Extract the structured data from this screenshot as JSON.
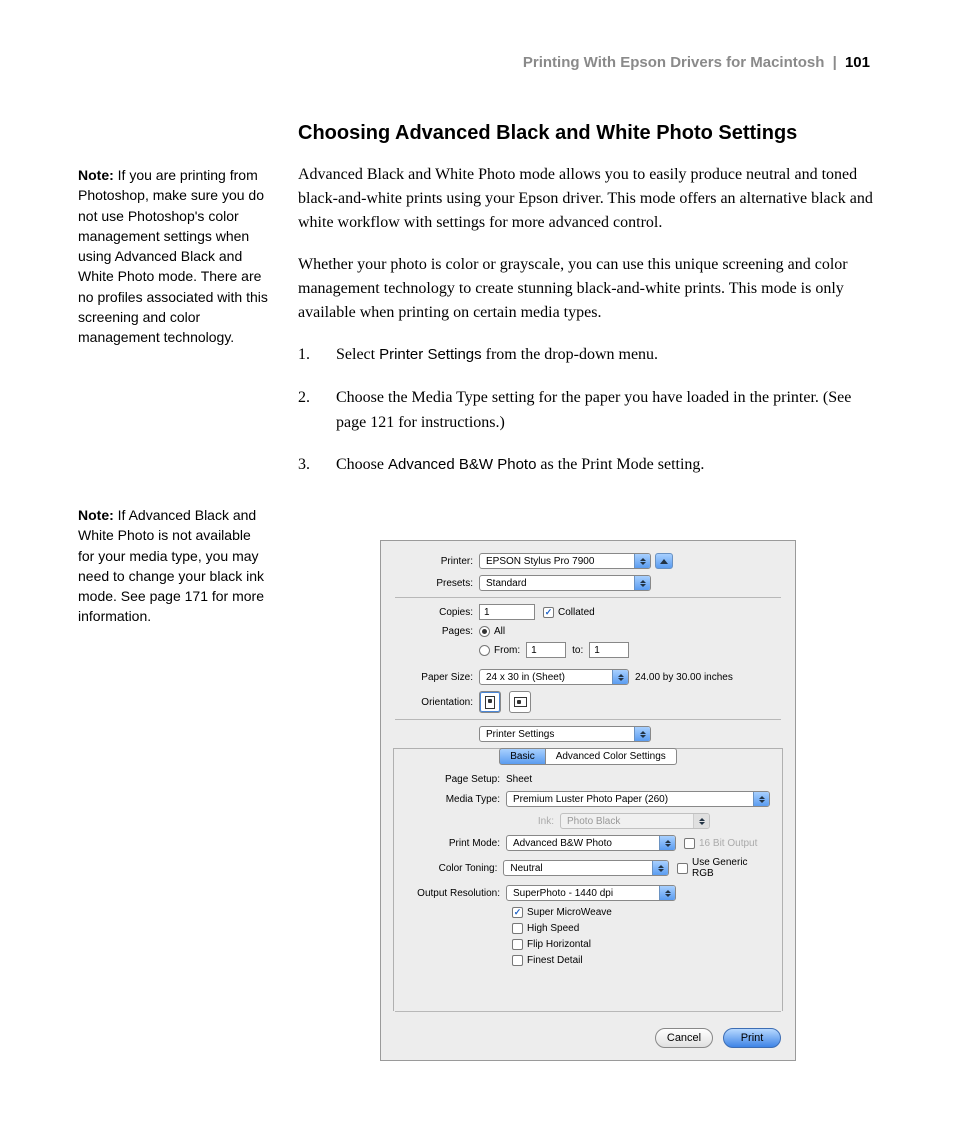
{
  "header": {
    "title": "Printing With Epson Drivers for Macintosh",
    "page": "101"
  },
  "section_title": "Choosing Advanced Black and White Photo Settings",
  "para1": "Advanced Black and White Photo mode allows you to easily produce neutral and toned black-and-white prints using your Epson driver. This mode offers an alternative black and white workflow with settings for more advanced control.",
  "para2": "Whether your photo is color or grayscale, you can use this unique screening and color management technology to create stunning black-and-white prints. This mode is only available when printing on certain media types.",
  "steps": {
    "s1_a": "Select ",
    "s1_b": "Printer Settings",
    "s1_c": " from the drop-down menu.",
    "s2": "Choose the Media Type setting for the paper you have loaded in the printer. (See page 121 for instructions.)",
    "s3_a": "Choose ",
    "s3_b": "Advanced B&W Photo",
    "s3_c": " as the Print Mode setting."
  },
  "notes": {
    "n1_label": "Note:",
    "n1": " If you are printing from Photoshop, make sure you do not use Photoshop's color management settings when using Advanced Black and White Photo mode. There are no profiles associated with this screening and color management technology.",
    "n2_label": "Note:",
    "n2": " If Advanced Black and White Photo is not available for your media type, you may need to change your black ink mode. See page 171 for more information."
  },
  "dialog": {
    "labels": {
      "printer": "Printer:",
      "presets": "Presets:",
      "copies": "Copies:",
      "pages": "Pages:",
      "paper_size": "Paper Size:",
      "orientation": "Orientation:",
      "page_setup": "Page Setup:",
      "media_type": "Media Type:",
      "ink": "Ink:",
      "print_mode": "Print Mode:",
      "color_toning": "Color Toning:",
      "output_res": "Output Resolution:"
    },
    "printer": "EPSON Stylus Pro 7900",
    "presets": "Standard",
    "copies": "1",
    "collated": "Collated",
    "pages_all": "All",
    "pages_from": "From:",
    "pages_from_v": "1",
    "pages_to": "to:",
    "pages_to_v": "1",
    "paper_size": "24 x 30 in (Sheet)",
    "paper_size_note": "24.00 by 30.00 inches",
    "section_select": "Printer Settings",
    "tab_basic": "Basic",
    "tab_adv": "Advanced Color Settings",
    "page_setup": "Sheet",
    "media_type": "Premium Luster Photo Paper (260)",
    "ink": "Photo Black",
    "print_mode": "Advanced B&W Photo",
    "sixteen_bit": "16 Bit Output",
    "color_toning": "Neutral",
    "use_generic": "Use Generic RGB",
    "output_res": "SuperPhoto - 1440 dpi",
    "chk1": "Super MicroWeave",
    "chk2": "High Speed",
    "chk3": "Flip Horizontal",
    "chk4": "Finest Detail",
    "cancel": "Cancel",
    "print": "Print"
  }
}
